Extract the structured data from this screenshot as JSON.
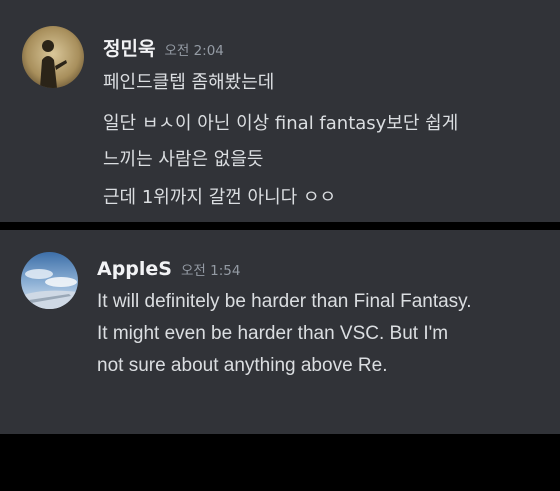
{
  "messages": [
    {
      "avatar_icon": "profile-photo-silhouette-icon",
      "username": "정민욱",
      "timestamp": "오전 2:04",
      "lines": [
        "페인드클텝 좀해봤는데",
        "일단 ㅂㅅ이 아닌 이상 final fantasy보단 쉽게",
        "느끼는 사람은 없을듯",
        "근데 1위까지 갈껀 아니다 ㅇㅇ"
      ]
    },
    {
      "avatar_icon": "profile-photo-sky-icon",
      "username": "AppleS",
      "timestamp": "오전 1:54",
      "lines": [
        "It will definitely be harder than Final Fantasy.",
        "It might even be harder than VSC. But I'm",
        "not sure about anything above Re."
      ]
    }
  ],
  "colors": {
    "background": "#313338",
    "border": "#000000",
    "username": "#f2f3f5",
    "timestamp": "#949ba4",
    "message_text": "#dbdee1"
  }
}
